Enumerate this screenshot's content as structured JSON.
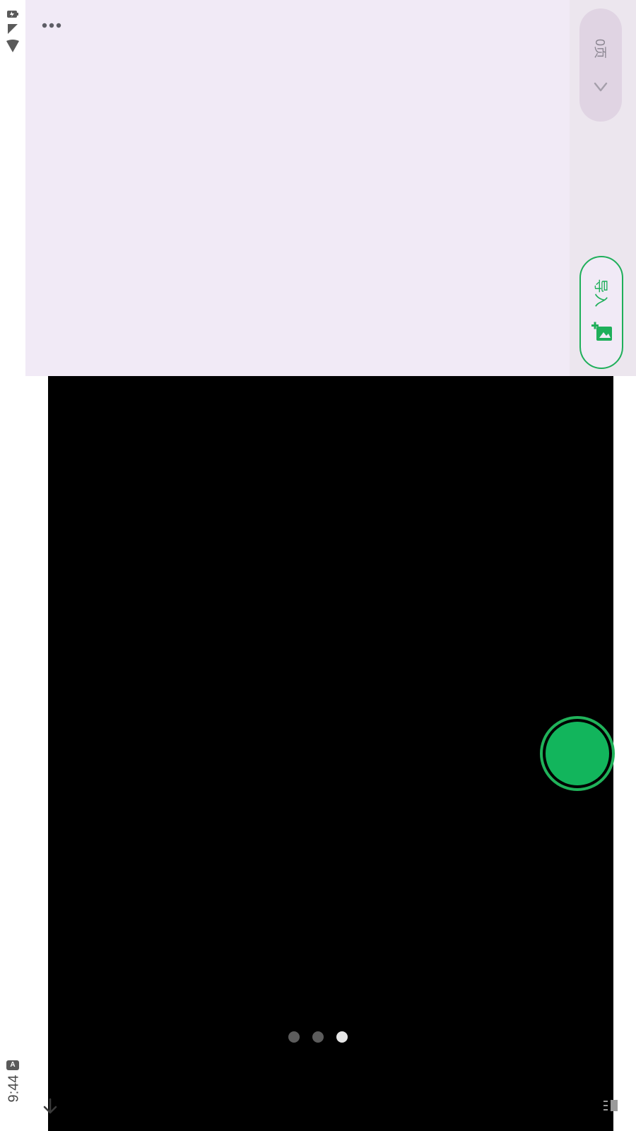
{
  "status_bar": {
    "time": "9:44",
    "a_badge": "A",
    "icons": [
      "battery-charging-icon",
      "signal-icon",
      "wifi-icon"
    ]
  },
  "top_panel": {
    "more_icon": "more-dots-icon"
  },
  "right_rail": {
    "page_count": "0页",
    "page_chevron_icon": "chevron-right-icon",
    "import_label": "导入",
    "import_icon": "add-image-icon"
  },
  "viewfinder": {
    "shutter_icon": "shutter-button",
    "page_indicator": {
      "total": 3,
      "active_index": 2
    }
  },
  "nav": {
    "back_icon": "arrow-down-icon",
    "corner_icon": "flash-icon"
  },
  "colors": {
    "accent": "#1faf5a",
    "panel_bg": "#f1eaf6",
    "viewfinder_bg": "#000000"
  }
}
